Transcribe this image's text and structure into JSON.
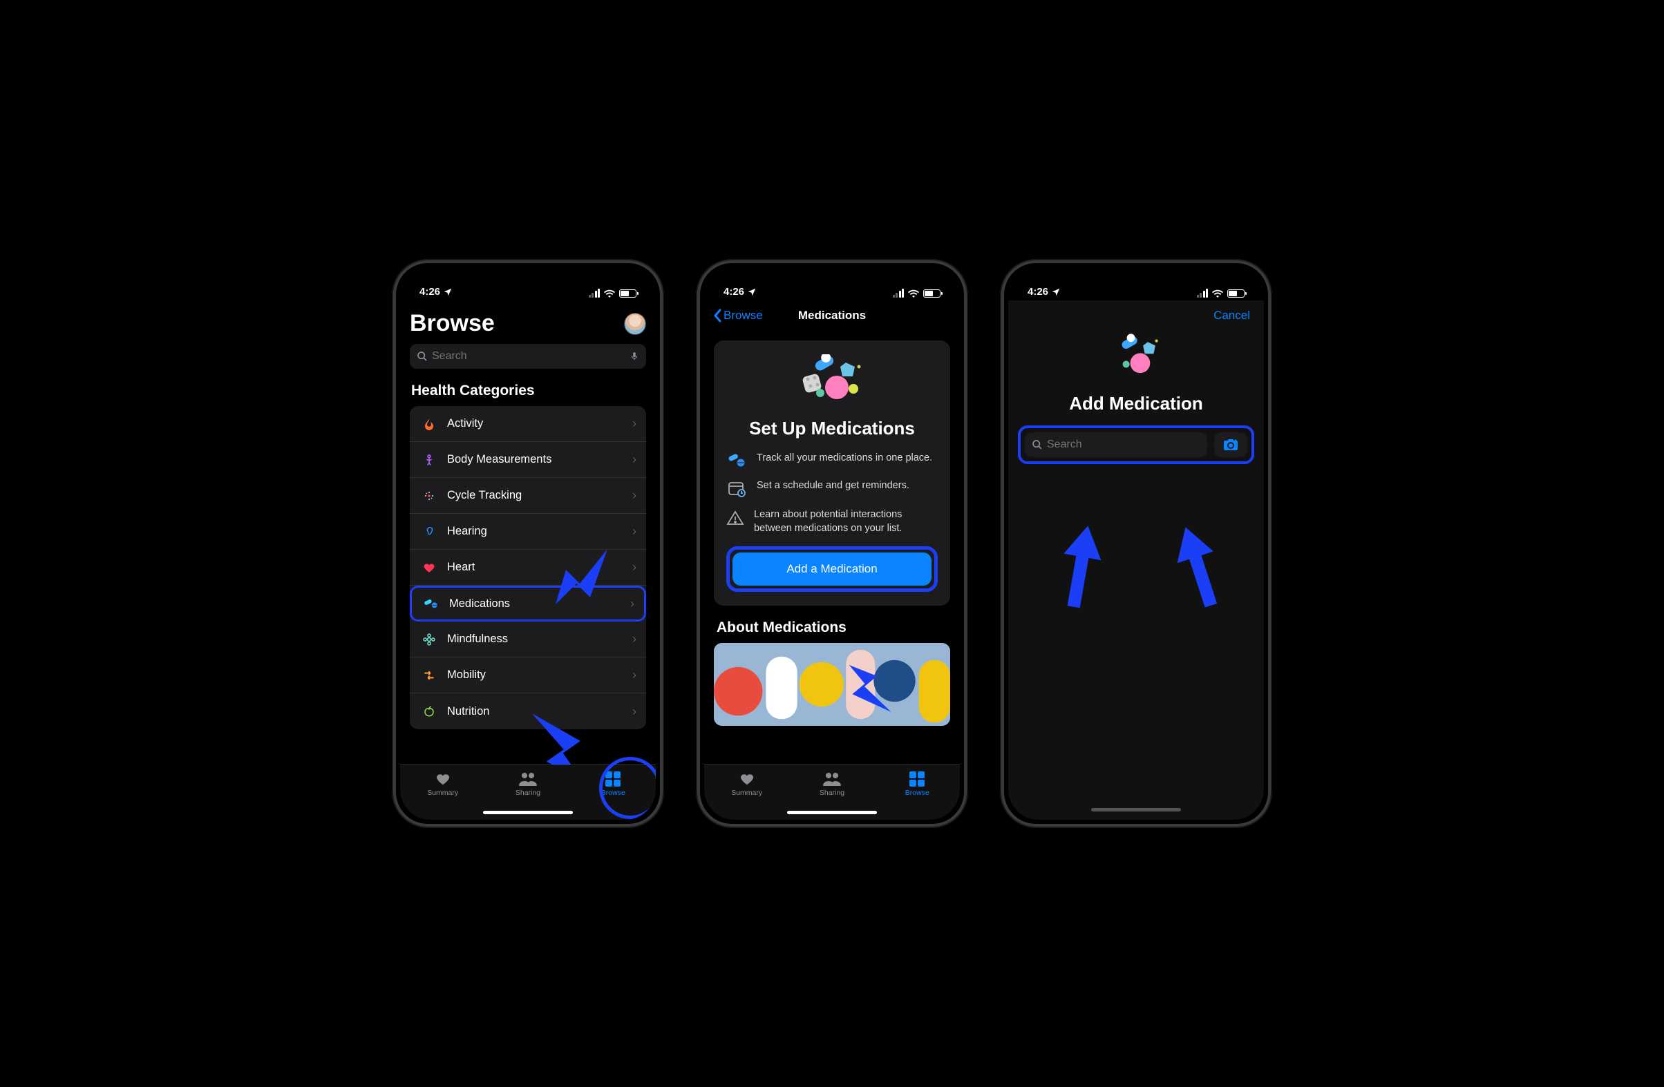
{
  "status": {
    "time": "4:26"
  },
  "p1": {
    "title": "Browse",
    "search_placeholder": "Search",
    "section": "Health Categories",
    "rows": [
      {
        "label": "Activity",
        "icon": "flame",
        "color": "#ff6a2e"
      },
      {
        "label": "Body Measurements",
        "icon": "person",
        "color": "#b25cff"
      },
      {
        "label": "Cycle Tracking",
        "icon": "cycle",
        "color": "#ff4a7d"
      },
      {
        "label": "Hearing",
        "icon": "ear",
        "color": "#2f8df6"
      },
      {
        "label": "Heart",
        "icon": "heart",
        "color": "#ff3356"
      },
      {
        "label": "Medications",
        "icon": "pills",
        "color": "#38d3ff"
      },
      {
        "label": "Mindfulness",
        "icon": "flower",
        "color": "#72e5d2"
      },
      {
        "label": "Mobility",
        "icon": "arrows",
        "color": "#ff9e2c"
      },
      {
        "label": "Nutrition",
        "icon": "apple",
        "color": "#8fe24a"
      }
    ],
    "tabs": {
      "summary": "Summary",
      "sharing": "Sharing",
      "browse": "Browse"
    }
  },
  "p2": {
    "back": "Browse",
    "title": "Medications",
    "card_title": "Set Up Medications",
    "features": [
      {
        "text": "Track all your medications in one place."
      },
      {
        "text": "Set a schedule and get reminders."
      },
      {
        "text": "Learn about potential interactions between medications on your list."
      }
    ],
    "add_button": "Add a Medication",
    "about_title": "About Medications",
    "tabs": {
      "summary": "Summary",
      "sharing": "Sharing",
      "browse": "Browse"
    }
  },
  "p3": {
    "cancel": "Cancel",
    "title": "Add Medication",
    "search_placeholder": "Search"
  }
}
